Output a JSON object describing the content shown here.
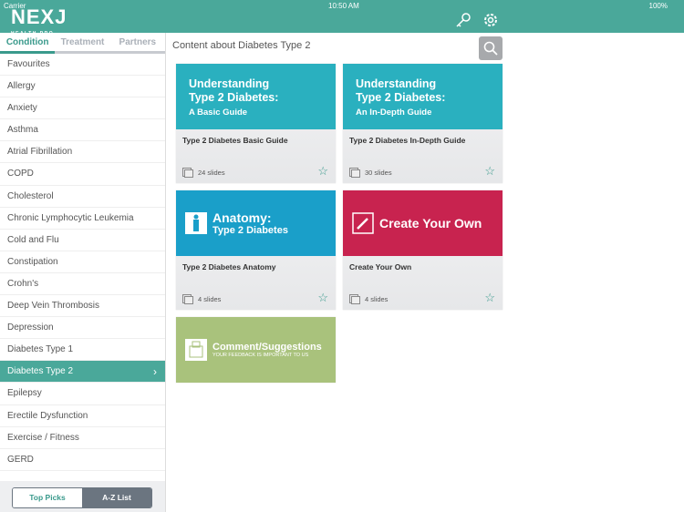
{
  "status": {
    "carrier": "Carrier",
    "time": "10:50 AM",
    "battery": "100%"
  },
  "app": {
    "logo": "NEXJ",
    "logo_sub": "HEALTH PRO"
  },
  "tabs": [
    {
      "label": "Condition"
    },
    {
      "label": "Treatment"
    },
    {
      "label": "Partners"
    }
  ],
  "conditions": [
    "Favourites",
    "Allergy",
    "Anxiety",
    "Asthma",
    "Atrial Fibrillation",
    "COPD",
    "Cholesterol",
    "Chronic Lymphocytic Leukemia",
    "Cold and Flu",
    "Constipation",
    "Crohn's",
    "Deep Vein Thrombosis",
    "Depression",
    "Diabetes Type 1",
    "Diabetes Type 2",
    "Epilepsy",
    "Erectile Dysfunction",
    "Exercise / Fitness",
    "GERD",
    ""
  ],
  "selected": "Diabetes Type 2",
  "toggle": {
    "top_picks": "Top Picks",
    "az": "A-Z List"
  },
  "heading": "Content about Diabetes Type 2",
  "cards": [
    {
      "thumb_l1": "Understanding",
      "thumb_l1b": "Type 2 Diabetes:",
      "thumb_l2": "A Basic Guide",
      "title": "Type 2 Diabetes Basic Guide",
      "slides": "24 slides",
      "color": "#2ab0bf"
    },
    {
      "thumb_l1": "Understanding",
      "thumb_l1b": "Type 2 Diabetes:",
      "thumb_l2": "An In-Depth Guide",
      "title": "Type 2 Diabetes In-Depth Guide",
      "slides": "30 slides",
      "color": "#2ab0bf"
    },
    {
      "thumb_l1": "Anatomy:",
      "thumb_l2": "Type 2 Diabetes",
      "title": "Type 2 Diabetes Anatomy",
      "slides": "4 slides",
      "color": "#1a9fc9"
    },
    {
      "thumb_l1": "Create Your Own",
      "title": "Create Your Own",
      "slides": "4 slides",
      "color": "#c8234f"
    }
  ],
  "feedback": {
    "title": "Comment/Suggestions",
    "sub": "YOUR FEEDBACK IS IMPORTANT TO US",
    "color": "#a9c27c"
  }
}
